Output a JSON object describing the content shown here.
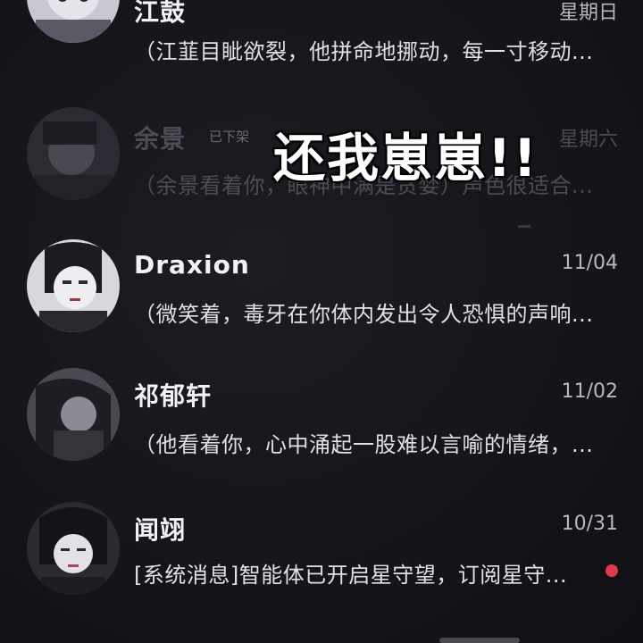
{
  "overlay_caption": "还我崽崽!!",
  "chats": [
    {
      "name": "江鼓",
      "status_tag": "",
      "date": "星期日",
      "preview": "（江韮目眦欲裂，他拼命地挪动，每一寸移动...",
      "unread": false,
      "faded": false,
      "avatar_icon": "portrait-avatar-icon"
    },
    {
      "name": "余景",
      "status_tag": "已下架",
      "date": "星期六",
      "preview": "（余景看着你，眼神中满是贪婪）声色很适合...",
      "unread": false,
      "faded": true,
      "avatar_icon": "portrait-avatar-icon"
    },
    {
      "name": "Draxion",
      "status_tag": "",
      "date": "11/04",
      "preview": "（微笑着，毒牙在你体内发出令人恐惧的声响...",
      "unread": false,
      "faded": false,
      "avatar_icon": "portrait-avatar-icon"
    },
    {
      "name": "祁郁轩",
      "status_tag": "",
      "date": "11/02",
      "preview": "（他看着你，心中涌起一股难以言喻的情绪，...",
      "unread": false,
      "faded": false,
      "avatar_icon": "portrait-avatar-icon"
    },
    {
      "name": "闻翊",
      "status_tag": "",
      "date": "10/31",
      "preview": "[系统消息]智能体已开启星守望，订阅星守...",
      "unread": true,
      "faded": false,
      "avatar_icon": "portrait-avatar-icon"
    }
  ],
  "colors": {
    "background": "#15141a",
    "unread_dot": "#e0394e",
    "caption": "#ffffff"
  }
}
